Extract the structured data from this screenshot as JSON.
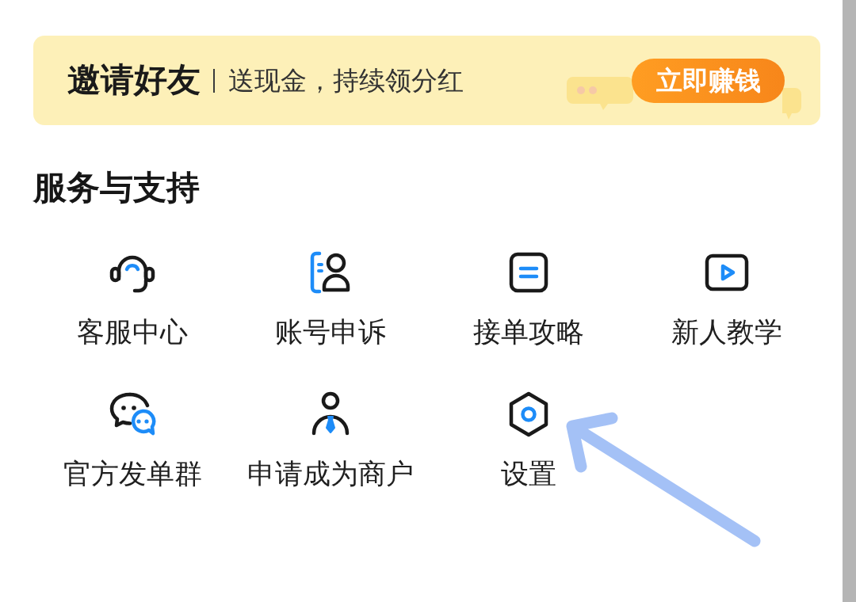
{
  "banner": {
    "title": "邀请好友",
    "subtitle": "送现金，持续领分红",
    "button": "立即赚钱"
  },
  "services": {
    "title": "服务与支持",
    "items": [
      {
        "kind": "headset",
        "label": "客服中心",
        "marked": false
      },
      {
        "kind": "account",
        "label": "账号申诉",
        "marked": false
      },
      {
        "kind": "guide",
        "label": "接单攻略",
        "marked": false
      },
      {
        "kind": "video",
        "label": "新人教学",
        "marked": false
      },
      {
        "kind": "chat",
        "label": "官方发单群",
        "marked": false
      },
      {
        "kind": "merchant",
        "label": "申请成为商户",
        "marked": false
      },
      {
        "kind": "settings",
        "label": "设置",
        "marked": true
      }
    ]
  }
}
